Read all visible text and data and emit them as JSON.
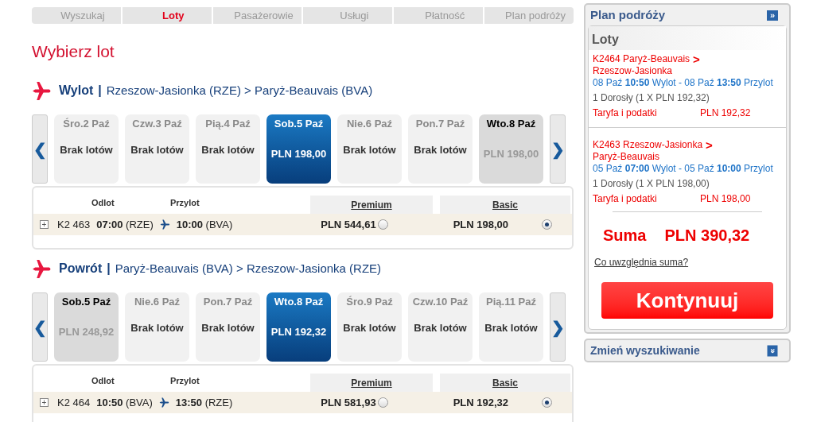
{
  "steps": [
    {
      "label": "Wyszukaj",
      "selected": false
    },
    {
      "label": "Loty",
      "selected": true
    },
    {
      "label": "Pasażerowie",
      "selected": false
    },
    {
      "label": "Usługi",
      "selected": false
    },
    {
      "label": "Płatność",
      "selected": false
    },
    {
      "label": "Plan podróży",
      "selected": false
    }
  ],
  "title": "Wybierz lot",
  "legs": [
    {
      "direction": "Wylot",
      "separator": "|",
      "route": "Rzeszow-Jasionka (RZE) > Paryż-Beauvais (BVA)",
      "prev": "❮",
      "next": "❯",
      "dates": [
        {
          "date": "Śro.2 Paź",
          "text": "Brak lotów",
          "kind": "empty",
          "selected": false
        },
        {
          "date": "Czw.3 Paź",
          "text": "Brak lotów",
          "kind": "empty",
          "selected": false
        },
        {
          "date": "Pią.4 Paź",
          "text": "Brak lotów",
          "kind": "empty",
          "selected": false
        },
        {
          "date": "Sob.5 Paź",
          "text": "PLN 198,00",
          "kind": "flights",
          "selected": true
        },
        {
          "date": "Nie.6 Paź",
          "text": "Brak lotów",
          "kind": "empty",
          "selected": false
        },
        {
          "date": "Pon.7 Paź",
          "text": "Brak lotów",
          "kind": "empty",
          "selected": false
        },
        {
          "date": "Wto.8 Paź",
          "text": "PLN 198,00",
          "kind": "flights",
          "selected": false
        }
      ],
      "columns": [
        "Odlot",
        "Przylot",
        "Premium",
        "Basic"
      ],
      "flight": {
        "expand": "+",
        "number": "K2 463",
        "departure": "**07:00** (RZE)",
        "arrival": "**10:00** (BVA)",
        "fares": [
          {
            "price": "PLN 544,61",
            "selected": false
          },
          {
            "price": "PLN 198,00",
            "selected": true
          }
        ]
      }
    },
    {
      "direction": "Powrót",
      "separator": "|",
      "route": "Paryż-Beauvais (BVA) > Rzeszow-Jasionka (RZE)",
      "prev": "❮",
      "next": "❯",
      "dates": [
        {
          "date": "Sob.5 Paź",
          "text": "PLN 248,92",
          "kind": "flights",
          "selected": false
        },
        {
          "date": "Nie.6 Paź",
          "text": "Brak lotów",
          "kind": "empty",
          "selected": false
        },
        {
          "date": "Pon.7 Paź",
          "text": "Brak lotów",
          "kind": "empty",
          "selected": false
        },
        {
          "date": "Wto.8 Paź",
          "text": "PLN 192,32",
          "kind": "flights",
          "selected": true
        },
        {
          "date": "Śro.9 Paź",
          "text": "Brak lotów",
          "kind": "empty",
          "selected": false
        },
        {
          "date": "Czw.10 Paź",
          "text": "Brak lotów",
          "kind": "empty",
          "selected": false
        },
        {
          "date": "Pią.11 Paź",
          "text": "Brak lotów",
          "kind": "empty",
          "selected": false
        }
      ],
      "columns": [
        "Odlot",
        "Przylot",
        "Premium",
        "Basic"
      ],
      "flight": {
        "expand": "+",
        "number": "K2 464",
        "departure": "**10:50** (BVA)",
        "arrival": "**13:50** (RZE)",
        "fares": [
          {
            "price": "PLN 581,93",
            "selected": false
          },
          {
            "price": "PLN 192,32",
            "selected": true
          }
        ]
      }
    }
  ],
  "sidebar": {
    "title": "Plan podróży",
    "toggle": "»",
    "section": "Loty",
    "segments": [
      {
        "route": "K2464 Paryż-Beauvais",
        "arrow": ">",
        "route_end": "Rzeszow-Jasionka",
        "times": "08 Paź **10:50** Wylot - 08 Paź **13:50** Przylot",
        "passengers": "1 Dorosły (1 X PLN 192,32)",
        "fare_label": "Taryfa i podatki",
        "fare": "PLN 192,32"
      },
      {
        "route": "K2463 Rzeszow-Jasionka",
        "arrow": ">",
        "route_end": "Paryż-Beauvais",
        "times": "05 Paź **07:00** Wylot - 05 Paź **10:00** Przylot",
        "passengers": "1 Dorosły (1 X PLN 198,00)",
        "fare_label": "Taryfa i podatki",
        "fare": "PLN 198,00"
      }
    ],
    "total_label": "Suma",
    "total": "PLN 390,32",
    "link": "Co uwzględnia suma?",
    "button": "Kontynuuj"
  },
  "search_panel": {
    "title": "Zmień wyszukiwanie",
    "toggle": "»"
  }
}
